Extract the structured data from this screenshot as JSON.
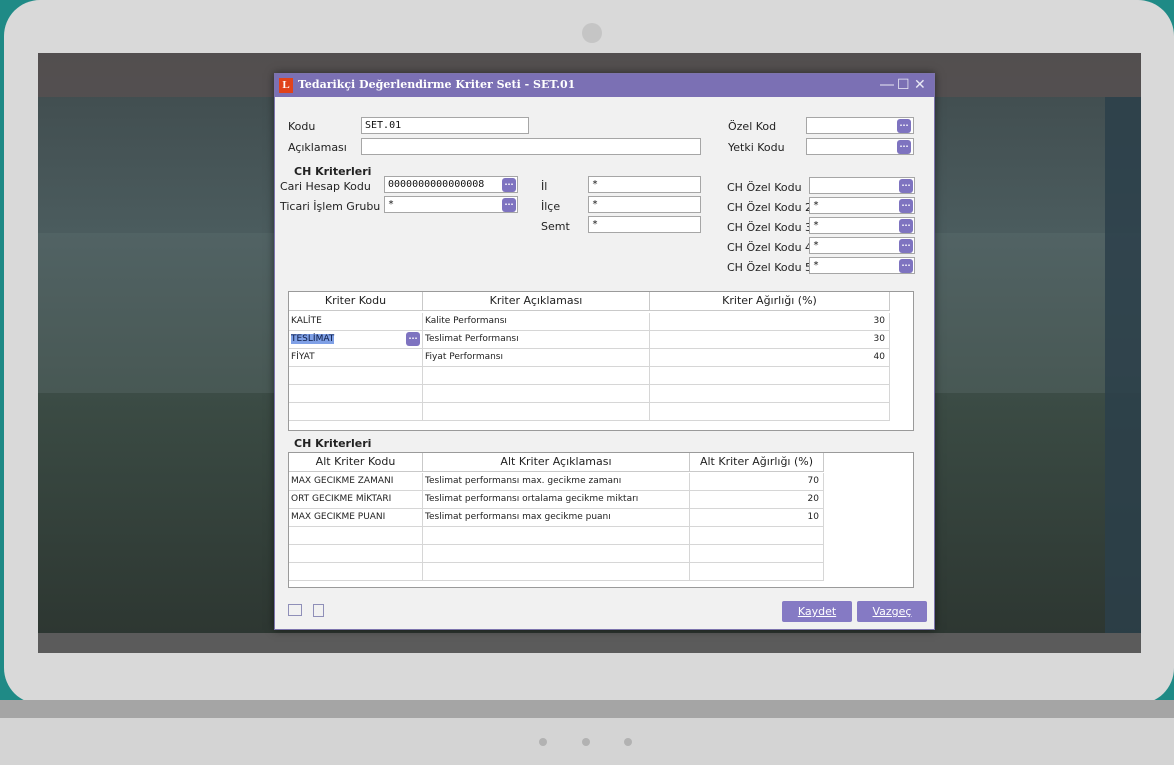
{
  "window": {
    "title": "Tedarikçi Değerlendirme Kriter Seti - SET.01",
    "logo_letter": "L"
  },
  "header": {
    "kodu_label": "Kodu",
    "kodu_value": "SET.01",
    "aciklama_label": "Açıklaması",
    "aciklama_value": "",
    "ozel_kod_label": "Özel Kod",
    "ozel_kod_value": "",
    "yetki_kodu_label": "Yetki Kodu",
    "yetki_kodu_value": ""
  },
  "ch_section": {
    "title": "CH Kriterleri",
    "cari_label": "Cari Hesap Kodu",
    "cari_value": "0000000000000008",
    "ticari_label": "Ticari İşlem Grubu",
    "ticari_value": "*",
    "il_label": "İl",
    "il_value": "*",
    "ilce_label": "İlçe",
    "ilce_value": "*",
    "semt_label": "Semt",
    "semt_value": "*",
    "ozel_kodlar": [
      {
        "label": "CH Özel Kodu",
        "value": ""
      },
      {
        "label": "CH Özel Kodu 2",
        "value": "*"
      },
      {
        "label": "CH Özel Kodu 3",
        "value": "*"
      },
      {
        "label": "CH Özel Kodu 4",
        "value": "*"
      },
      {
        "label": "CH Özel Kodu 5",
        "value": "*"
      }
    ]
  },
  "criteria_table": {
    "headers": [
      "Kriter Kodu",
      "Kriter Açıklaması",
      "Kriter Ağırlığı (%)"
    ],
    "rows": [
      {
        "code": "KALİTE",
        "desc": "Kalite Performansı",
        "weight": "30"
      },
      {
        "code": "TESLİMAT",
        "desc": "Teslimat Performansı",
        "weight": "30"
      },
      {
        "code": "FİYAT",
        "desc": "Fiyat Performansı",
        "weight": "40"
      }
    ]
  },
  "sub_section_title": "CH Kriterleri",
  "sub_table": {
    "headers": [
      "Alt Kriter Kodu",
      "Alt Kriter Açıklaması",
      "Alt Kriter Ağırlığı (%)"
    ],
    "rows": [
      {
        "code": "MAX GECIKME ZAMANI",
        "desc": "Teslimat performansı max. gecikme zamanı",
        "weight": "70"
      },
      {
        "code": "ORT GECIKME MİKTARI",
        "desc": "Teslimat performansı ortalama gecikme miktarı",
        "weight": "20"
      },
      {
        "code": "MAX GECIKME PUANI",
        "desc": "Teslimat performansı max gecikme puanı",
        "weight": "10"
      }
    ]
  },
  "buttons": {
    "save_label": "Kaydet",
    "cancel_label": "Vazgeç"
  },
  "icons": {
    "logo": "logo-icon",
    "book": "book-icon",
    "document": "document-icon",
    "lookup": "ellipsis-icon"
  },
  "colors": {
    "titlebar": "#7b70b4",
    "button": "#857ac4",
    "selection": "#7fa0e6"
  }
}
